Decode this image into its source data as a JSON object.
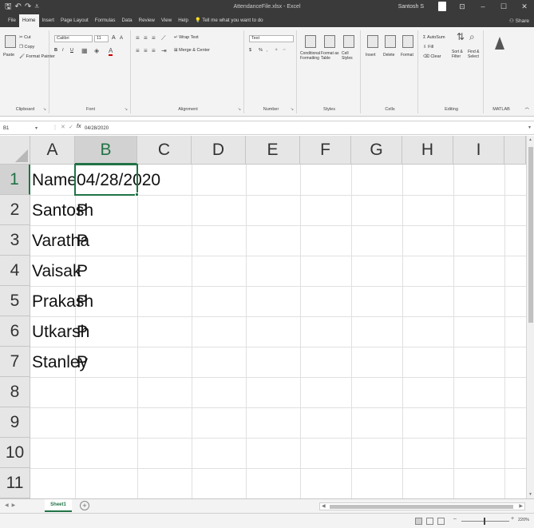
{
  "window": {
    "title": "AttendanceFile.xlsx - Excel",
    "user": "Santosh S",
    "minimize": "–",
    "restore": "☐",
    "close": "✕",
    "ribbon_display": "⊡",
    "quick_access": {
      "save": "🖫",
      "undo": "↶",
      "redo": "↷",
      "customize": "⩡"
    }
  },
  "menu": {
    "tabs": [
      "File",
      "Home",
      "Insert",
      "Page Layout",
      "Formulas",
      "Data",
      "Review",
      "View",
      "Help",
      "Tell me what you want to do"
    ],
    "active_tab": "Home",
    "share": "Share"
  },
  "ribbon": {
    "clipboard": {
      "paste": "Paste",
      "cut": "Cut",
      "copy": "Copy",
      "format_painter": "Format Painter",
      "label": "Clipboard"
    },
    "font": {
      "name": "Calibri",
      "size": "11",
      "bold": "B",
      "italic": "I",
      "underline": "U",
      "grow": "A",
      "shrink": "A",
      "label": "Font"
    },
    "alignment": {
      "wrap_text": "Wrap Text",
      "merge_center": "Merge & Center",
      "label": "Alignment"
    },
    "number": {
      "format": "Text",
      "label": "Number",
      "percent": "%",
      "comma": ",",
      "currency": "$"
    },
    "styles": {
      "conditional": "Conditional Formatting",
      "format_as_table": "Format as Table",
      "cell_styles": "Cell Styles",
      "label": "Styles"
    },
    "cells": {
      "insert": "Insert",
      "delete": "Delete",
      "format": "Format",
      "label": "Cells"
    },
    "editing": {
      "autosum": "AutoSum",
      "fill": "Fill",
      "clear": "Clear",
      "sort_filter": "Sort & Filter",
      "find_select": "Find & Select",
      "label": "Editing"
    },
    "matlab": {
      "label": "MATLAB"
    }
  },
  "formula_bar": {
    "name_box": "B1",
    "value": "04/28/2020",
    "fx": "fx",
    "cancel": "✕",
    "enter": "✓"
  },
  "grid": {
    "columns": [
      "A",
      "B",
      "C",
      "D",
      "E",
      "F",
      "G",
      "H",
      "I"
    ],
    "rows": [
      "1",
      "2",
      "3",
      "4",
      "5",
      "6",
      "7",
      "8",
      "9",
      "10",
      "11"
    ],
    "cells": {
      "A1": "Name",
      "B1": "04/28/2020",
      "A2": "Santosh",
      "B2": "P",
      "A3": "Varatha",
      "B3": "P",
      "A4": "Vaisak",
      "B4": "P",
      "A5": "Prakash",
      "B5": "P",
      "A6": "Utkarsh",
      "B6": "P",
      "A7": "Stanley",
      "B7": "P"
    },
    "selected_cell": "B1"
  },
  "sheets": {
    "tabs": [
      "Sheet1"
    ],
    "active": "Sheet1",
    "add": "+"
  },
  "status": {
    "zoom": "220%",
    "zoom_minus": "–",
    "zoom_plus": "+"
  },
  "colors": {
    "excel_green": "#217346",
    "title_bar": "#3a3a3a",
    "ribbon_bg": "#f3f3f3"
  }
}
